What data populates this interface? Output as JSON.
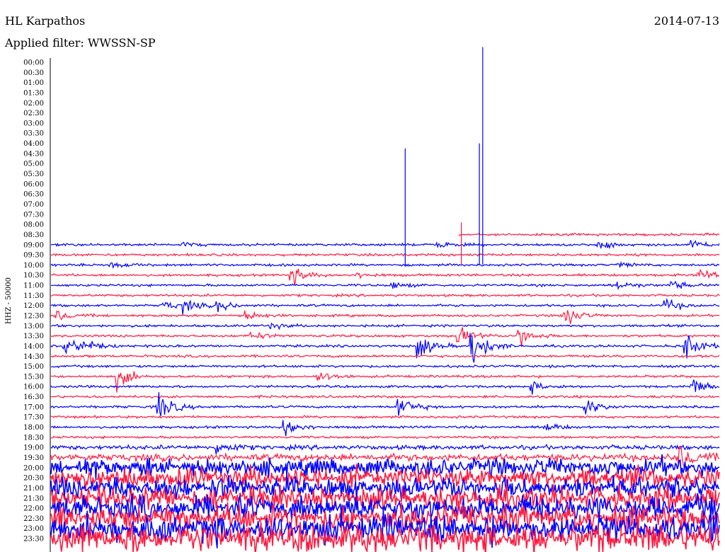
{
  "header": {
    "station": "HL Karpathos",
    "date": "2014-07-13",
    "filter_prefix": "Applied filter: ",
    "filter_name": "WWSSN-SP"
  },
  "chart_data": {
    "type": "line",
    "title": "HL Karpathos",
    "ylabel": "HHZ - 50000",
    "colors": [
      "#0000ff",
      "#ff1a40"
    ],
    "rows": [
      "00:00",
      "00:30",
      "01:00",
      "01:30",
      "02:00",
      "02:30",
      "03:00",
      "03:30",
      "04:00",
      "04:30",
      "05:00",
      "05:30",
      "06:00",
      "06:30",
      "07:00",
      "07:30",
      "08:00",
      "08:30",
      "09:00",
      "09:30",
      "10:00",
      "10:30",
      "11:00",
      "11:30",
      "12:00",
      "12:30",
      "13:00",
      "13:30",
      "14:00",
      "14:30",
      "15:00",
      "15:30",
      "16:00",
      "16:30",
      "17:00",
      "17:30",
      "18:00",
      "18:30",
      "19:00",
      "19:30",
      "20:00",
      "20:30",
      "21:00",
      "21:30",
      "22:00",
      "22:30",
      "23:00",
      "23:30"
    ],
    "record_start": "08:30",
    "record_start_fraction": 0.61,
    "grid": false,
    "events": [
      {
        "row": "09:00",
        "pos": 0.2,
        "amp": 0.5
      },
      {
        "row": "09:00",
        "pos": 0.58,
        "amp": 0.6
      },
      {
        "row": "09:00",
        "pos": 0.82,
        "amp": 1.0
      },
      {
        "row": "09:00",
        "pos": 0.96,
        "amp": 1.2
      },
      {
        "row": "10:00",
        "pos": 0.09,
        "amp": 0.7
      },
      {
        "row": "10:00",
        "pos": 0.85,
        "amp": 0.6
      },
      {
        "row": "10:30",
        "pos": 0.36,
        "amp": 2.2
      },
      {
        "row": "10:30",
        "pos": 0.46,
        "amp": 0.6
      },
      {
        "row": "10:30",
        "pos": 0.97,
        "amp": 1.3
      },
      {
        "row": "11:00",
        "pos": 0.51,
        "amp": 0.8
      },
      {
        "row": "11:00",
        "pos": 0.85,
        "amp": 1.0
      },
      {
        "row": "11:00",
        "pos": 0.93,
        "amp": 1.0
      },
      {
        "row": "12:00",
        "pos": 0.17,
        "amp": 1.0
      },
      {
        "row": "12:00",
        "pos": 0.2,
        "amp": 1.3
      },
      {
        "row": "12:00",
        "pos": 0.25,
        "amp": 1.4
      },
      {
        "row": "12:00",
        "pos": 0.92,
        "amp": 1.5
      },
      {
        "row": "12:30",
        "pos": 0.01,
        "amp": 1.2
      },
      {
        "row": "12:30",
        "pos": 0.29,
        "amp": 1.3
      },
      {
        "row": "12:30",
        "pos": 0.77,
        "amp": 2.5
      },
      {
        "row": "13:00",
        "pos": 0.33,
        "amp": 0.7
      },
      {
        "row": "13:30",
        "pos": 0.3,
        "amp": 1.0
      },
      {
        "row": "13:30",
        "pos": 0.61,
        "amp": 2.2
      },
      {
        "row": "13:30",
        "pos": 0.7,
        "amp": 2.4
      },
      {
        "row": "14:00",
        "pos": 0.02,
        "amp": 2.4
      },
      {
        "row": "14:00",
        "pos": 0.05,
        "amp": 1.2
      },
      {
        "row": "14:00",
        "pos": 0.55,
        "amp": 3.0
      },
      {
        "row": "14:00",
        "pos": 0.63,
        "amp": 5.0
      },
      {
        "row": "14:00",
        "pos": 0.95,
        "amp": 3.0
      },
      {
        "row": "15:30",
        "pos": 0.1,
        "amp": 2.6
      },
      {
        "row": "15:30",
        "pos": 0.4,
        "amp": 1.3
      },
      {
        "row": "16:00",
        "pos": 0.72,
        "amp": 1.2
      },
      {
        "row": "16:00",
        "pos": 0.96,
        "amp": 2.0
      },
      {
        "row": "17:00",
        "pos": 0.16,
        "amp": 4.0
      },
      {
        "row": "17:00",
        "pos": 0.52,
        "amp": 3.0
      },
      {
        "row": "17:00",
        "pos": 0.8,
        "amp": 2.0
      },
      {
        "row": "18:00",
        "pos": 0.35,
        "amp": 2.5
      },
      {
        "row": "18:00",
        "pos": 0.74,
        "amp": 1.0
      },
      {
        "row": "19:00",
        "pos": 0.25,
        "amp": 1.5
      },
      {
        "row": "19:30",
        "pos": 0.94,
        "amp": 3.0
      }
    ],
    "spikes": [
      {
        "row": "09:00",
        "pos": 0.53,
        "height": 9.5,
        "color": "#0000ff"
      },
      {
        "row": "09:00",
        "pos": 0.614,
        "height": 2.2,
        "color": "#ff1a40"
      },
      {
        "row": "09:00",
        "pos": 0.641,
        "height": 10.0,
        "color": "#0000ff"
      },
      {
        "row": "09:00",
        "pos": 0.646,
        "height": 19.5,
        "color": "#0000ff"
      }
    ]
  }
}
